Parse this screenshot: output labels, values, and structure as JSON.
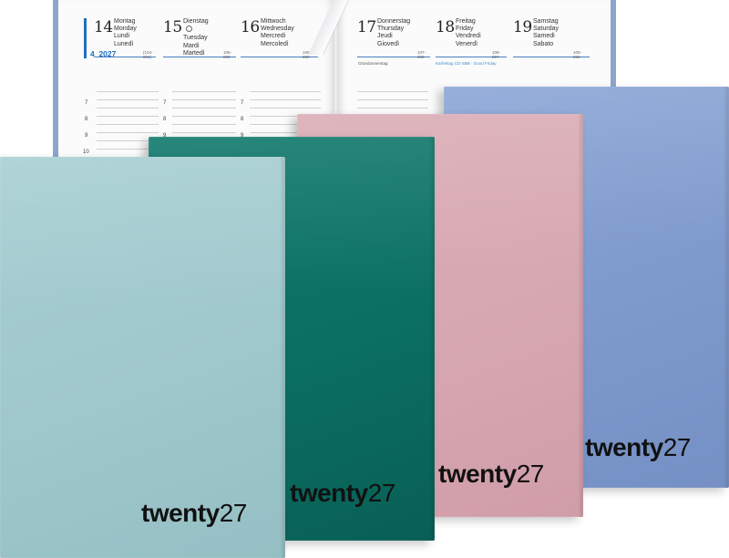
{
  "planner": {
    "week_label": "4_2027",
    "days": [
      {
        "num": "14",
        "names": [
          "Montag",
          "Monday",
          "Lundi",
          "Lunedì"
        ],
        "code": "(104-261)"
      },
      {
        "num": "15",
        "names": [
          "Dienstag",
          "Tuesday",
          "Mardi",
          "Martedì"
        ],
        "code": "105-260"
      },
      {
        "num": "16",
        "names": [
          "Mittwoch",
          "Wednesday",
          "Mercredi",
          "Mercoledì"
        ],
        "code": "106-259"
      },
      {
        "num": "17",
        "names": [
          "Donnerstag",
          "Thursday",
          "Jeudi",
          "Giovedì"
        ],
        "code": "107-258"
      },
      {
        "num": "18",
        "names": [
          "Freitag",
          "Friday",
          "Vendredi",
          "Venerdì"
        ],
        "code": "108-257"
      },
      {
        "num": "19",
        "names": [
          "Samstag",
          "Saturday",
          "Samedi",
          "Sabato"
        ],
        "code": "109-256"
      }
    ],
    "note_thursday": "Gründonnerstag",
    "note_friday": "Karfreitag CD·SBB · Good Friday",
    "hours": [
      "7",
      "8",
      "9",
      "10"
    ]
  },
  "covers": [
    {
      "color": "#a7cfd3",
      "brand_word": "twenty",
      "brand_num": "27"
    },
    {
      "color": "#0b6f63",
      "brand_word": "twenty",
      "brand_num": "27"
    },
    {
      "color": "#d7a7b1",
      "brand_word": "twenty",
      "brand_num": "27"
    },
    {
      "color": "#7d98cb",
      "brand_word": "twenty",
      "brand_num": "27"
    }
  ]
}
